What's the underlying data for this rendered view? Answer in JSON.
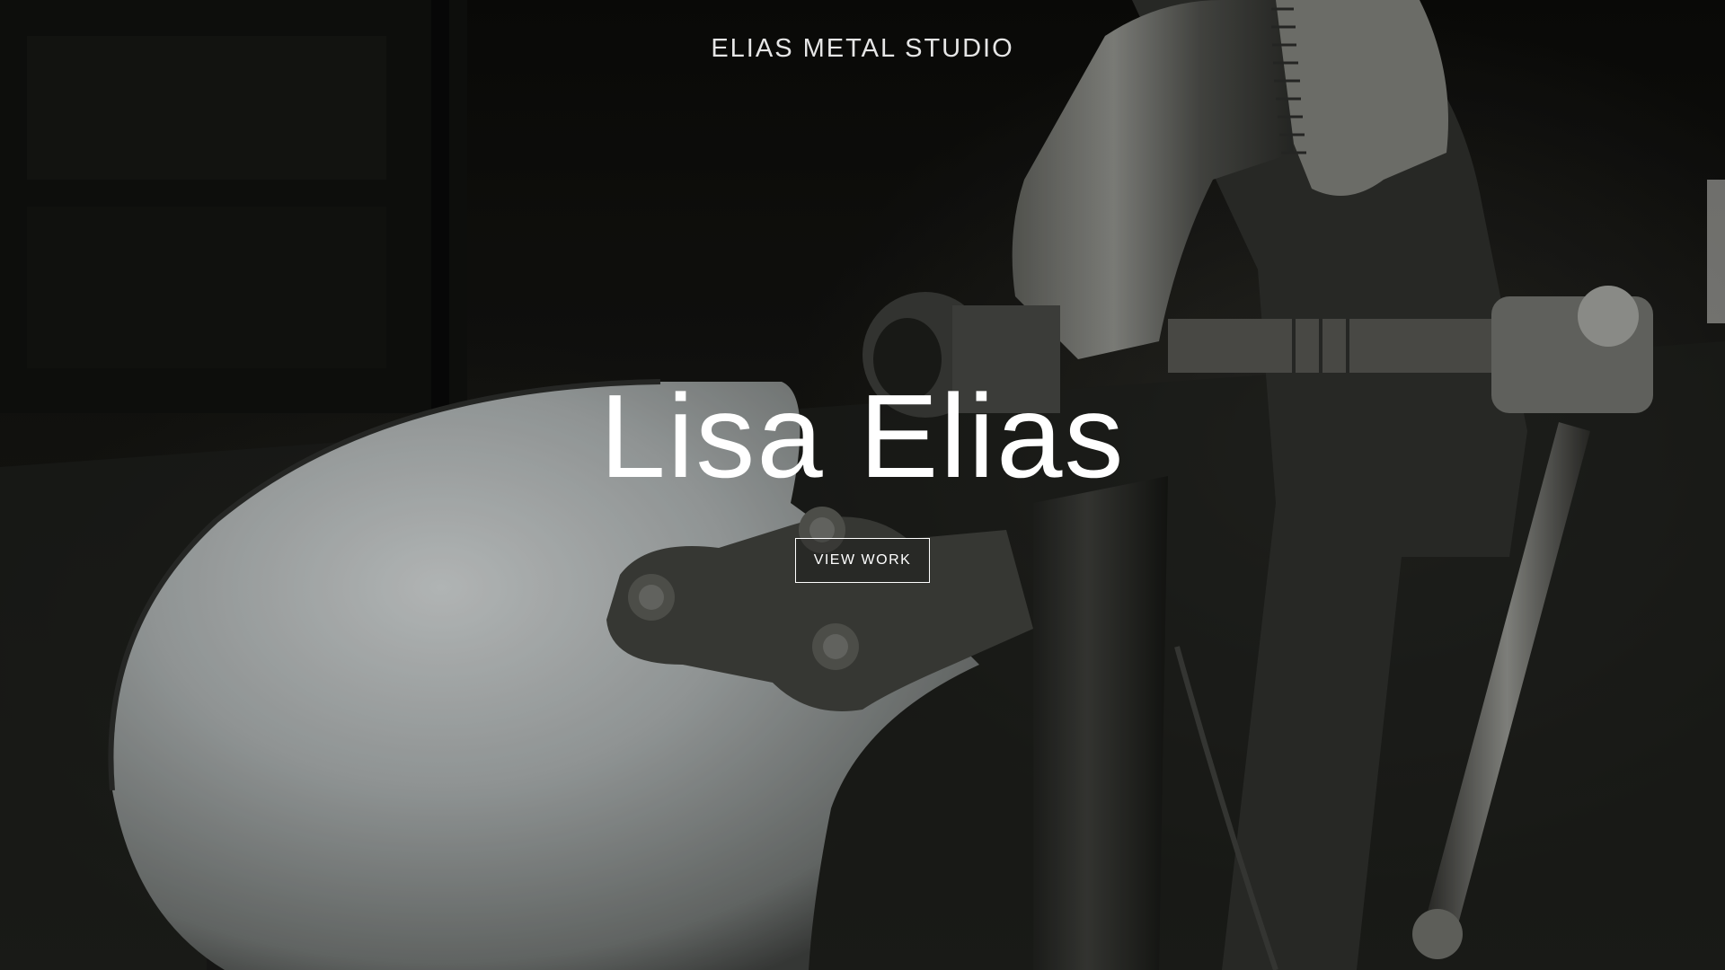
{
  "header": {
    "studio_name": "ELIAS METAL STUDIO"
  },
  "hero": {
    "title": "Lisa Elias",
    "cta_label": "VIEW WORK",
    "background_description_icon": "metal-vise-photo"
  },
  "colors": {
    "text": "#ffffff",
    "background": "#0a0a08",
    "metal_light": "#b8bcbc",
    "metal_dark": "#3a3a36"
  }
}
